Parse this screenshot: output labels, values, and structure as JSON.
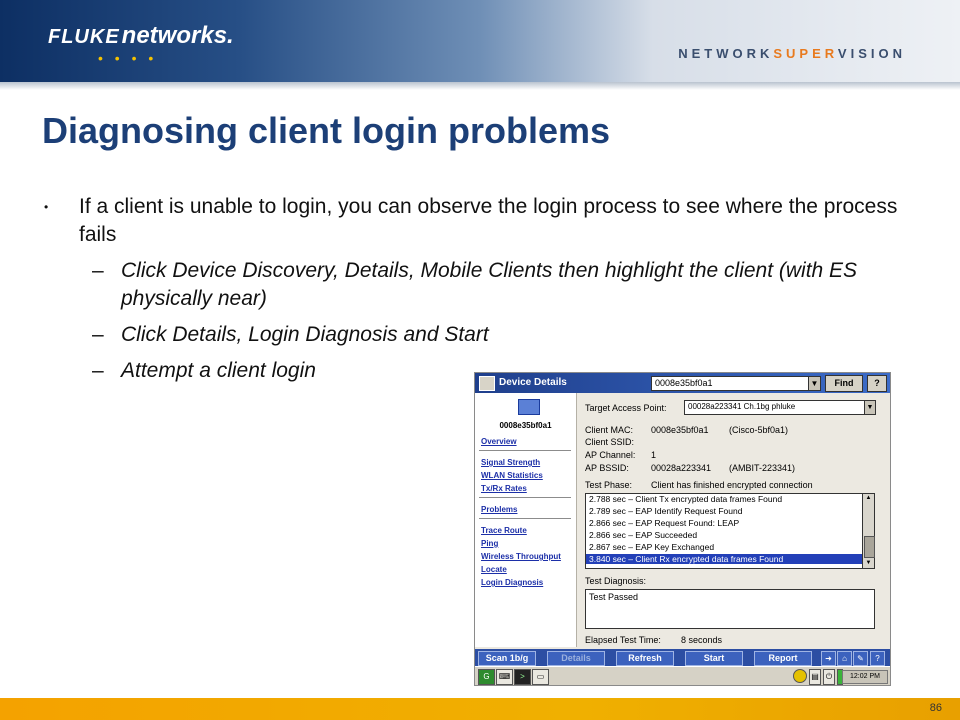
{
  "brand": {
    "logo_fluke": "FLUKE",
    "logo_networks": "networks.",
    "tagline_pre": "NETWORK",
    "tagline_accent": "SUPER",
    "tagline_post": "VISION"
  },
  "slide": {
    "title": "Diagnosing client login problems",
    "bullet": "If a client is unable to login, you can observe the login process to see where the process fails",
    "subs": [
      "Click Device Discovery, Details, Mobile Clients then highlight the client (with ES physically near)",
      "Click Details, Login Diagnosis and Start",
      "Attempt a client login"
    ],
    "page_number": "86"
  },
  "app": {
    "window_title": "Device Details",
    "search_value": "0008e35bf0a1",
    "find_label": "Find",
    "help_label": "?",
    "device_id": "0008e35bf0a1",
    "sidebar": [
      "Overview",
      "Signal Strength",
      "WLAN Statistics",
      "Tx/Rx Rates",
      "Problems",
      "Trace Route",
      "Ping",
      "Wireless Throughput",
      "Locate",
      "Login Diagnosis"
    ],
    "target_ap_label": "Target Access Point:",
    "target_ap_value": "00028a223341 Ch.1bg  phluke",
    "client_mac_label": "Client MAC:",
    "client_mac_value": "0008e35bf0a1",
    "client_mac_vendor": "(Cisco-5bf0a1)",
    "client_ssid_label": "Client SSID:",
    "ap_channel_label": "AP Channel:",
    "ap_channel_value": "1",
    "ap_bssid_label": "AP BSSID:",
    "ap_bssid_value": "00028a223341",
    "ap_bssid_vendor": "(AMBIT-223341)",
    "test_phase_label": "Test Phase:",
    "test_phase_value": "Client has finished encrypted connection",
    "log": [
      "2.788 sec – Client Tx encrypted data frames Found",
      "2.789 sec – EAP Identify Request Found",
      "2.866 sec – EAP Request Found: LEAP",
      "2.866 sec – EAP Succeeded",
      "2.867 sec – EAP Key Exchanged",
      "3.840 sec – Client Rx encrypted data frames Found"
    ],
    "test_diagnosis_label": "Test Diagnosis:",
    "test_diagnosis_value": "Test Passed",
    "elapsed_label": "Elapsed Test Time:",
    "elapsed_value": "8 seconds",
    "buttons": [
      "Scan 1b/g",
      "Details",
      "Refresh",
      "Start",
      "Report"
    ],
    "clock": "12:02 PM"
  }
}
